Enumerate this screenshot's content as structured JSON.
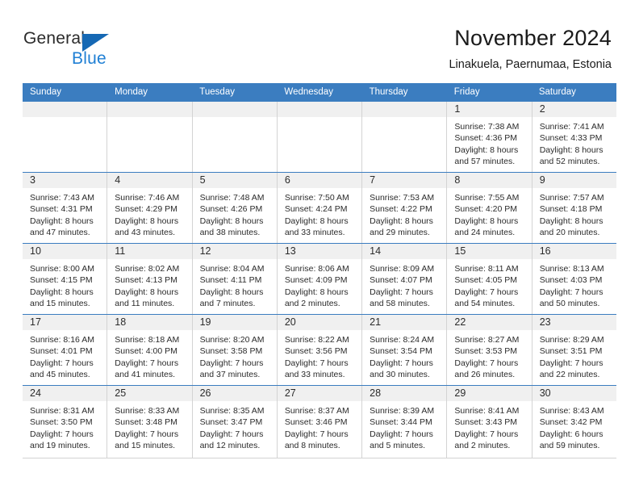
{
  "brand": {
    "logo_text_primary": "General",
    "logo_text_secondary": "Blue",
    "logo_triangle_icon": "blue-triangle-icon",
    "accent_color": "#3b7dc0",
    "logo_blue": "#1f7fd4"
  },
  "header": {
    "title": "November 2024",
    "subtitle": "Linakuela, Paernumaa, Estonia"
  },
  "weekdays": [
    "Sunday",
    "Monday",
    "Tuesday",
    "Wednesday",
    "Thursday",
    "Friday",
    "Saturday"
  ],
  "weeks": [
    [
      {
        "day": "",
        "lines": []
      },
      {
        "day": "",
        "lines": []
      },
      {
        "day": "",
        "lines": []
      },
      {
        "day": "",
        "lines": []
      },
      {
        "day": "",
        "lines": []
      },
      {
        "day": "1",
        "lines": [
          "Sunrise: 7:38 AM",
          "Sunset: 4:36 PM",
          "Daylight: 8 hours",
          "and 57 minutes."
        ]
      },
      {
        "day": "2",
        "lines": [
          "Sunrise: 7:41 AM",
          "Sunset: 4:33 PM",
          "Daylight: 8 hours",
          "and 52 minutes."
        ]
      }
    ],
    [
      {
        "day": "3",
        "lines": [
          "Sunrise: 7:43 AM",
          "Sunset: 4:31 PM",
          "Daylight: 8 hours",
          "and 47 minutes."
        ]
      },
      {
        "day": "4",
        "lines": [
          "Sunrise: 7:46 AM",
          "Sunset: 4:29 PM",
          "Daylight: 8 hours",
          "and 43 minutes."
        ]
      },
      {
        "day": "5",
        "lines": [
          "Sunrise: 7:48 AM",
          "Sunset: 4:26 PM",
          "Daylight: 8 hours",
          "and 38 minutes."
        ]
      },
      {
        "day": "6",
        "lines": [
          "Sunrise: 7:50 AM",
          "Sunset: 4:24 PM",
          "Daylight: 8 hours",
          "and 33 minutes."
        ]
      },
      {
        "day": "7",
        "lines": [
          "Sunrise: 7:53 AM",
          "Sunset: 4:22 PM",
          "Daylight: 8 hours",
          "and 29 minutes."
        ]
      },
      {
        "day": "8",
        "lines": [
          "Sunrise: 7:55 AM",
          "Sunset: 4:20 PM",
          "Daylight: 8 hours",
          "and 24 minutes."
        ]
      },
      {
        "day": "9",
        "lines": [
          "Sunrise: 7:57 AM",
          "Sunset: 4:18 PM",
          "Daylight: 8 hours",
          "and 20 minutes."
        ]
      }
    ],
    [
      {
        "day": "10",
        "lines": [
          "Sunrise: 8:00 AM",
          "Sunset: 4:15 PM",
          "Daylight: 8 hours",
          "and 15 minutes."
        ]
      },
      {
        "day": "11",
        "lines": [
          "Sunrise: 8:02 AM",
          "Sunset: 4:13 PM",
          "Daylight: 8 hours",
          "and 11 minutes."
        ]
      },
      {
        "day": "12",
        "lines": [
          "Sunrise: 8:04 AM",
          "Sunset: 4:11 PM",
          "Daylight: 8 hours",
          "and 7 minutes."
        ]
      },
      {
        "day": "13",
        "lines": [
          "Sunrise: 8:06 AM",
          "Sunset: 4:09 PM",
          "Daylight: 8 hours",
          "and 2 minutes."
        ]
      },
      {
        "day": "14",
        "lines": [
          "Sunrise: 8:09 AM",
          "Sunset: 4:07 PM",
          "Daylight: 7 hours",
          "and 58 minutes."
        ]
      },
      {
        "day": "15",
        "lines": [
          "Sunrise: 8:11 AM",
          "Sunset: 4:05 PM",
          "Daylight: 7 hours",
          "and 54 minutes."
        ]
      },
      {
        "day": "16",
        "lines": [
          "Sunrise: 8:13 AM",
          "Sunset: 4:03 PM",
          "Daylight: 7 hours",
          "and 50 minutes."
        ]
      }
    ],
    [
      {
        "day": "17",
        "lines": [
          "Sunrise: 8:16 AM",
          "Sunset: 4:01 PM",
          "Daylight: 7 hours",
          "and 45 minutes."
        ]
      },
      {
        "day": "18",
        "lines": [
          "Sunrise: 8:18 AM",
          "Sunset: 4:00 PM",
          "Daylight: 7 hours",
          "and 41 minutes."
        ]
      },
      {
        "day": "19",
        "lines": [
          "Sunrise: 8:20 AM",
          "Sunset: 3:58 PM",
          "Daylight: 7 hours",
          "and 37 minutes."
        ]
      },
      {
        "day": "20",
        "lines": [
          "Sunrise: 8:22 AM",
          "Sunset: 3:56 PM",
          "Daylight: 7 hours",
          "and 33 minutes."
        ]
      },
      {
        "day": "21",
        "lines": [
          "Sunrise: 8:24 AM",
          "Sunset: 3:54 PM",
          "Daylight: 7 hours",
          "and 30 minutes."
        ]
      },
      {
        "day": "22",
        "lines": [
          "Sunrise: 8:27 AM",
          "Sunset: 3:53 PM",
          "Daylight: 7 hours",
          "and 26 minutes."
        ]
      },
      {
        "day": "23",
        "lines": [
          "Sunrise: 8:29 AM",
          "Sunset: 3:51 PM",
          "Daylight: 7 hours",
          "and 22 minutes."
        ]
      }
    ],
    [
      {
        "day": "24",
        "lines": [
          "Sunrise: 8:31 AM",
          "Sunset: 3:50 PM",
          "Daylight: 7 hours",
          "and 19 minutes."
        ]
      },
      {
        "day": "25",
        "lines": [
          "Sunrise: 8:33 AM",
          "Sunset: 3:48 PM",
          "Daylight: 7 hours",
          "and 15 minutes."
        ]
      },
      {
        "day": "26",
        "lines": [
          "Sunrise: 8:35 AM",
          "Sunset: 3:47 PM",
          "Daylight: 7 hours",
          "and 12 minutes."
        ]
      },
      {
        "day": "27",
        "lines": [
          "Sunrise: 8:37 AM",
          "Sunset: 3:46 PM",
          "Daylight: 7 hours",
          "and 8 minutes."
        ]
      },
      {
        "day": "28",
        "lines": [
          "Sunrise: 8:39 AM",
          "Sunset: 3:44 PM",
          "Daylight: 7 hours",
          "and 5 minutes."
        ]
      },
      {
        "day": "29",
        "lines": [
          "Sunrise: 8:41 AM",
          "Sunset: 3:43 PM",
          "Daylight: 7 hours",
          "and 2 minutes."
        ]
      },
      {
        "day": "30",
        "lines": [
          "Sunrise: 8:43 AM",
          "Sunset: 3:42 PM",
          "Daylight: 6 hours",
          "and 59 minutes."
        ]
      }
    ]
  ]
}
